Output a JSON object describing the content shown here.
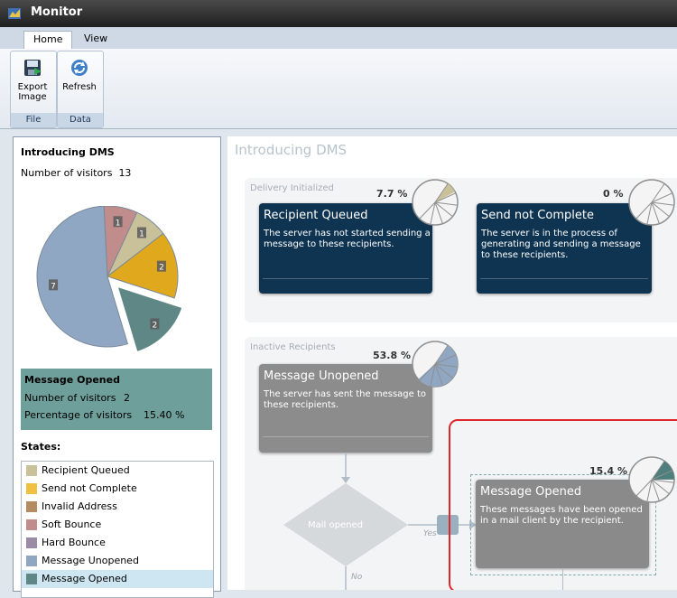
{
  "window": {
    "title": "Monitor"
  },
  "ribbon": {
    "tabs": [
      "Home",
      "View"
    ],
    "groups": [
      {
        "label": "File",
        "buttons": [
          {
            "label": "Export Image",
            "icon": "export-image-icon"
          }
        ]
      },
      {
        "label": "Data",
        "buttons": [
          {
            "label": "Refresh",
            "icon": "refresh-icon"
          }
        ]
      }
    ]
  },
  "sidebar": {
    "title": "Introducing DMS",
    "visitors_label": "Number of visitors",
    "visitors_count": "13",
    "pie": {
      "slices": [
        {
          "name": "Message Unopened",
          "value": 7,
          "label": "7",
          "color": "#8fa7c2"
        },
        {
          "name": "Soft Bounce",
          "value": 1,
          "label": "1",
          "color": "#c08c8c"
        },
        {
          "name": "Recipient Queued",
          "value": 1,
          "label": "1",
          "color": "#c9c19a"
        },
        {
          "name": "Send not Complete",
          "value": 2,
          "label": "2",
          "color": "#e0a81d"
        },
        {
          "name": "Message Opened",
          "value": 2,
          "label": "2",
          "color": "#5e8785",
          "exploded": true
        }
      ]
    },
    "info": {
      "title": "Message Opened",
      "visitors_label": "Number of visitors",
      "visitors_value": "2",
      "percentage_label": "Percentage of visitors",
      "percentage_value": "15.40 %"
    },
    "states_title": "States:",
    "states": [
      {
        "label": "Recipient Queued",
        "color": "#c9c19a"
      },
      {
        "label": "Send not Complete",
        "color": "#f0c040"
      },
      {
        "label": "Invalid Address",
        "color": "#b58b62"
      },
      {
        "label": "Soft Bounce",
        "color": "#c08c8c"
      },
      {
        "label": "Hard Bounce",
        "color": "#9b8aa6"
      },
      {
        "label": "Message Unopened",
        "color": "#8fa7c2"
      },
      {
        "label": "Message Opened",
        "color": "#5e8785",
        "selected": true
      }
    ]
  },
  "diagram": {
    "title": "Introducing DMS",
    "groups": [
      {
        "label": "Delivery Initialized"
      },
      {
        "label": "Inactive Recipients"
      }
    ],
    "cards": {
      "recipient_queued": {
        "title": "Recipient Queued",
        "desc": "The server has not started sending a message to these recipients.",
        "pct": "7.7 %",
        "fraction": 0.077
      },
      "send_not_complete": {
        "title": "Send not Complete",
        "desc": "The server is in the process of generating and sending a message to these recipients.",
        "pct": "0 %",
        "fraction": 0
      },
      "message_unopened": {
        "title": "Message Unopened",
        "desc": "The server has sent the message to these recipients.",
        "pct": "53.8 %",
        "fraction": 0.538
      },
      "message_opened": {
        "title": "Message Opened",
        "desc": "These messages have been opened in a mail client by the recipient.",
        "pct": "15.4 %",
        "fraction": 0.154
      }
    },
    "decision": {
      "label": "Mail opened",
      "yes": "Yes",
      "no": "No"
    }
  }
}
